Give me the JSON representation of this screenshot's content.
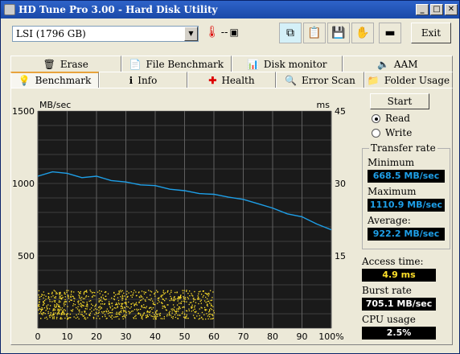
{
  "window": {
    "title": "HD Tune Pro 3.00 - Hard Disk Utility"
  },
  "toolbar": {
    "drive": "LSI (1796 GB)",
    "temperature": "--",
    "exit_label": "Exit"
  },
  "tabs_row1": [
    {
      "label": "Erase",
      "icon": "trash-icon"
    },
    {
      "label": "File Benchmark",
      "icon": "file-benchmark-icon"
    },
    {
      "label": "Disk monitor",
      "icon": "disk-monitor-icon"
    },
    {
      "label": "AAM",
      "icon": "speaker-icon"
    }
  ],
  "tabs_row2": [
    {
      "label": "Benchmark",
      "icon": "bulb-icon",
      "active": true
    },
    {
      "label": "Info",
      "icon": "info-icon"
    },
    {
      "label": "Health",
      "icon": "health-cross-icon"
    },
    {
      "label": "Error Scan",
      "icon": "magnifier-icon"
    },
    {
      "label": "Folder Usage",
      "icon": "folder-icon"
    }
  ],
  "controls": {
    "start_label": "Start",
    "read_label": "Read",
    "write_label": "Write",
    "mode_selected": "Read"
  },
  "transfer": {
    "group_label": "Transfer rate",
    "min_label": "Minimum",
    "min_value": "668.5 MB/sec",
    "max_label": "Maximum",
    "max_value": "1110.9 MB/sec",
    "avg_label": "Average:",
    "avg_value": "922.2 MB/sec"
  },
  "access": {
    "label": "Access time:",
    "value": "4.9 ms"
  },
  "burst": {
    "label": "Burst rate",
    "value": "705.1 MB/sec"
  },
  "cpu": {
    "label": "CPU usage",
    "value": "2.5%"
  },
  "colors": {
    "transfer_line": "#1e9fe8",
    "access_points": "#ffe02a",
    "chart_bg": "#1a1a1a",
    "grid": "#606060"
  },
  "chart_data": {
    "type": "line",
    "ylabel_left": "MB/sec",
    "ylabel_right": "ms",
    "ylim_left": [
      0,
      1500
    ],
    "ylim_right": [
      0,
      45
    ],
    "left_ticks": [
      "1500",
      "1000",
      "500"
    ],
    "right_ticks": [
      "45",
      "30",
      "15"
    ],
    "x_ticks": [
      "0",
      "10",
      "20",
      "30",
      "40",
      "50",
      "60",
      "70",
      "80",
      "90",
      "100%"
    ],
    "grid": true,
    "series": [
      {
        "type": "line",
        "x": [
          0,
          5,
          10,
          15,
          20,
          25,
          30,
          35,
          40,
          45,
          50,
          55,
          60,
          65,
          70,
          75,
          80,
          85,
          90,
          95,
          100
        ],
        "y": [
          1050,
          1080,
          1070,
          1040,
          1050,
          1020,
          1010,
          990,
          985,
          960,
          950,
          930,
          925,
          905,
          890,
          860,
          830,
          790,
          770,
          720,
          680
        ]
      },
      {
        "type": "scatter",
        "x_range": [
          0,
          60
        ],
        "y_range_ms": [
          2,
          8
        ]
      }
    ]
  }
}
